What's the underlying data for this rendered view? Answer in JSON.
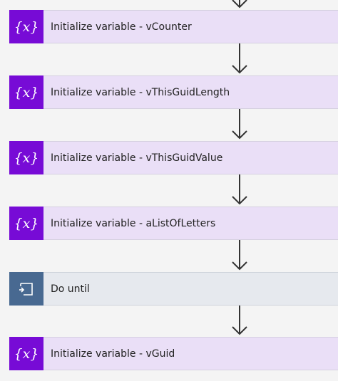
{
  "colors": {
    "variable_step_bg": "#eadff7",
    "variable_icon_bg": "#770bd6",
    "loop_step_bg": "#e6e9ee",
    "loop_icon_bg": "#486991",
    "connector": "#333333",
    "canvas_bg": "#f4f4f4"
  },
  "steps": [
    {
      "icon": "variable-icon",
      "label": "Initialize variable - vCounter"
    },
    {
      "icon": "variable-icon",
      "label": "Initialize variable - vThisGuidLength"
    },
    {
      "icon": "variable-icon",
      "label": "Initialize variable - vThisGuidValue"
    },
    {
      "icon": "variable-icon",
      "label": "Initialize variable - aListOfLetters"
    },
    {
      "icon": "loop-icon",
      "label": "Do until"
    },
    {
      "icon": "variable-icon",
      "label": "Initialize variable - vGuid"
    }
  ]
}
